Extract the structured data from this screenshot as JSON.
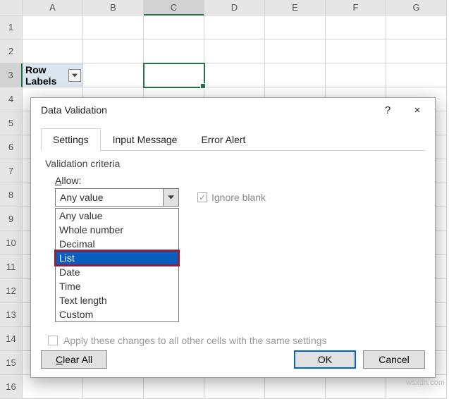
{
  "grid": {
    "columns": [
      "A",
      "B",
      "C",
      "D",
      "E",
      "F",
      "G"
    ],
    "row_count": 16,
    "active_col": "C",
    "active_row": 3,
    "pivot_label": "Row Labels"
  },
  "dialog": {
    "title": "Data Validation",
    "help_label": "?",
    "close_label": "×",
    "tabs": {
      "settings": "Settings",
      "input_message": "Input Message",
      "error_alert": "Error Alert"
    },
    "criteria_label": "Validation criteria",
    "allow_label": "Allow:",
    "combo_value": "Any value",
    "ignore_blank": "Ignore blank",
    "options": {
      "any": "Any value",
      "whole": "Whole number",
      "decimal": "Decimal",
      "list": "List",
      "date": "Date",
      "time": "Time",
      "textlen": "Text length",
      "custom": "Custom"
    },
    "apply_all": "Apply these changes to all other cells with the same settings",
    "buttons": {
      "clear": "Clear All",
      "ok": "OK",
      "cancel": "Cancel"
    }
  },
  "watermark": "wsxdn.com"
}
